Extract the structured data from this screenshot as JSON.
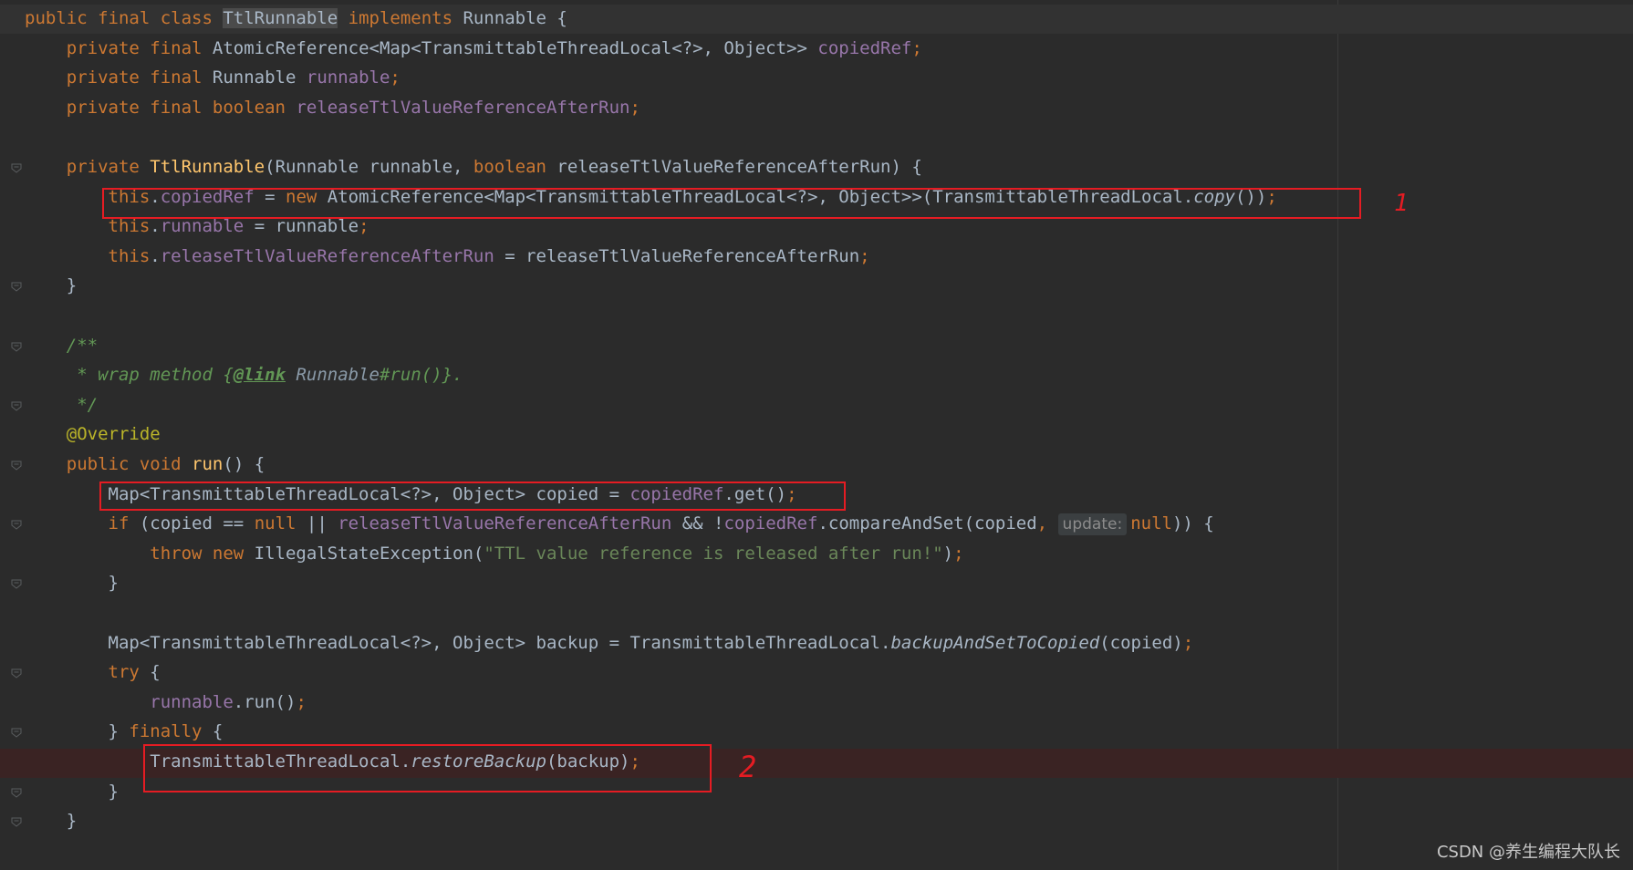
{
  "editor": {
    "lines": [
      {
        "indent": "",
        "tokens": [
          [
            "kw",
            "public final class "
          ],
          [
            "sel",
            "TtlRunnable"
          ],
          [
            "kw",
            " implements "
          ],
          [
            "",
            "Runnable {"
          ]
        ]
      },
      {
        "indent": "    ",
        "tokens": [
          [
            "kw",
            "private final "
          ],
          [
            "",
            "AtomicReference<Map<TransmittableThreadLocal<?>, Object>> "
          ],
          [
            "field",
            "copiedRef"
          ],
          [
            "kw",
            ";"
          ]
        ]
      },
      {
        "indent": "    ",
        "tokens": [
          [
            "kw",
            "private final "
          ],
          [
            "",
            "Runnable "
          ],
          [
            "field",
            "runnable"
          ],
          [
            "kw",
            ";"
          ]
        ]
      },
      {
        "indent": "    ",
        "tokens": [
          [
            "kw",
            "private final boolean "
          ],
          [
            "field",
            "releaseTtlValueReferenceAfterRun"
          ],
          [
            "kw",
            ";"
          ]
        ]
      },
      {
        "indent": "",
        "tokens": []
      },
      {
        "indent": "    ",
        "tokens": [
          [
            "kw",
            "private "
          ],
          [
            "method",
            "TtlRunnable"
          ],
          [
            "",
            "(Runnable runnable, "
          ],
          [
            "kw",
            "boolean "
          ],
          [
            "",
            "releaseTtlValueReferenceAfterRun) {"
          ]
        ]
      },
      {
        "indent": "        ",
        "tokens": [
          [
            "kw",
            "this"
          ],
          [
            "",
            "."
          ],
          [
            "field",
            "copiedRef"
          ],
          [
            "",
            " = "
          ],
          [
            "kw",
            "new "
          ],
          [
            "",
            "AtomicReference<Map<TransmittableThreadLocal<?>, Object>>(TransmittableThreadLocal."
          ],
          [
            "ital",
            "copy"
          ],
          [
            "",
            "())"
          ],
          [
            "kw",
            ";"
          ]
        ]
      },
      {
        "indent": "        ",
        "tokens": [
          [
            "kw",
            "this"
          ],
          [
            "",
            "."
          ],
          [
            "field",
            "runnable"
          ],
          [
            "",
            " = runnable"
          ],
          [
            "kw",
            ";"
          ]
        ]
      },
      {
        "indent": "        ",
        "tokens": [
          [
            "kw",
            "this"
          ],
          [
            "",
            "."
          ],
          [
            "field",
            "releaseTtlValueReferenceAfterRun"
          ],
          [
            "",
            " = releaseTtlValueReferenceAfterRun"
          ],
          [
            "kw",
            ";"
          ]
        ]
      },
      {
        "indent": "    ",
        "tokens": [
          [
            "",
            "}"
          ]
        ]
      },
      {
        "indent": "",
        "tokens": []
      },
      {
        "indent": "    ",
        "tokens": [
          [
            "cmt",
            "/**"
          ]
        ]
      },
      {
        "indent": "     ",
        "tokens": [
          [
            "cmt",
            "* wrap method {"
          ],
          [
            "tag",
            "@link"
          ],
          [
            "cmt",
            " "
          ],
          [
            "cmtref",
            "Runnable"
          ],
          [
            "cmt",
            "#run()}."
          ]
        ]
      },
      {
        "indent": "     ",
        "tokens": [
          [
            "cmt",
            "*/"
          ]
        ]
      },
      {
        "indent": "    ",
        "tokens": [
          [
            "ann",
            "@Override"
          ]
        ]
      },
      {
        "indent": "    ",
        "tokens": [
          [
            "kw",
            "public void "
          ],
          [
            "method",
            "run"
          ],
          [
            "",
            "() {"
          ]
        ]
      },
      {
        "indent": "        ",
        "tokens": [
          [
            "",
            "Map<TransmittableThreadLocal<?>, Object> copied = "
          ],
          [
            "field",
            "copiedRef"
          ],
          [
            "",
            ".get()"
          ],
          [
            "kw",
            ";"
          ]
        ]
      },
      {
        "indent": "        ",
        "tokens": [
          [
            "kw",
            "if "
          ],
          [
            "",
            "(copied == "
          ],
          [
            "kw",
            "null "
          ],
          [
            "",
            "|| "
          ],
          [
            "field",
            "releaseTtlValueReferenceAfterRun "
          ],
          [
            "",
            "&& !"
          ],
          [
            "field",
            "copiedRef"
          ],
          [
            "",
            ".compareAndSet(copied"
          ],
          [
            "kw",
            ", "
          ],
          [
            "hint",
            "update:"
          ],
          [
            "kw",
            "null"
          ],
          [
            "",
            ")) {"
          ]
        ]
      },
      {
        "indent": "            ",
        "tokens": [
          [
            "kw",
            "throw new "
          ],
          [
            "",
            "IllegalStateException("
          ],
          [
            "str",
            "\"TTL value reference is released after run!\""
          ],
          [
            "",
            ")"
          ],
          [
            "kw",
            ";"
          ]
        ]
      },
      {
        "indent": "        ",
        "tokens": [
          [
            "",
            "}"
          ]
        ]
      },
      {
        "indent": "",
        "tokens": []
      },
      {
        "indent": "        ",
        "tokens": [
          [
            "",
            "Map<TransmittableThreadLocal<?>, Object> backup = TransmittableThreadLocal."
          ],
          [
            "ital",
            "backupAndSetToCopied"
          ],
          [
            "",
            "(copied)"
          ],
          [
            "kw",
            ";"
          ]
        ]
      },
      {
        "indent": "        ",
        "tokens": [
          [
            "kw",
            "try "
          ],
          [
            "",
            "{"
          ]
        ]
      },
      {
        "indent": "            ",
        "tokens": [
          [
            "field",
            "runnable"
          ],
          [
            "",
            ".run()"
          ],
          [
            "kw",
            ";"
          ]
        ]
      },
      {
        "indent": "        ",
        "tokens": [
          [
            "",
            "} "
          ],
          [
            "kw",
            "finally "
          ],
          [
            "",
            "{"
          ]
        ]
      },
      {
        "indent": "            ",
        "tokens": [
          [
            "",
            "TransmittableThreadLocal."
          ],
          [
            "ital",
            "restoreBackup"
          ],
          [
            "",
            "(backup)"
          ],
          [
            "kw",
            ";"
          ]
        ]
      },
      {
        "indent": "        ",
        "tokens": [
          [
            "",
            "}"
          ]
        ]
      },
      {
        "indent": "    ",
        "tokens": [
          [
            "",
            "}"
          ]
        ]
      }
    ]
  },
  "annotations": {
    "note_1": "1",
    "note_2": "2"
  },
  "watermark": "CSDN @养生编程大队长",
  "colors": {
    "keyword": "#cc7832",
    "field": "#9876aa",
    "string": "#6a8759",
    "comment": "#629755",
    "annotation": "#bbb529",
    "method": "#ffc66d",
    "plain": "#a9b7c6",
    "background": "#2b2b2b",
    "highlight_box": "#e51c23"
  }
}
